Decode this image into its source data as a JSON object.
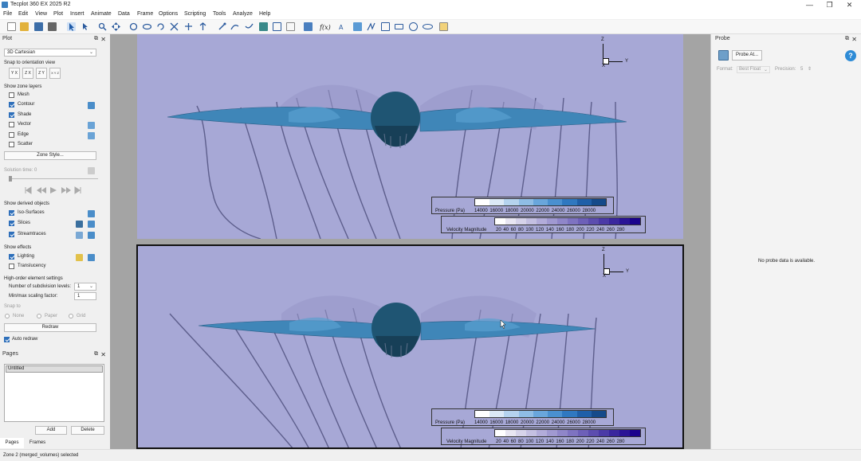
{
  "window": {
    "title": "Tecplot 360 EX 2025 R2",
    "controls": [
      "—",
      "❐",
      "✕"
    ]
  },
  "menu": [
    "File",
    "Edit",
    "View",
    "Plot",
    "Insert",
    "Animate",
    "Data",
    "Frame",
    "Options",
    "Scripting",
    "Tools",
    "Analyze",
    "Help"
  ],
  "plot_panel": {
    "title": "Plot",
    "plot_type": "3D Cartesian",
    "snap_label": "Snap to orientation view",
    "snap_views": [
      "Y X",
      "Z X",
      "Z Y",
      "X Y Z"
    ],
    "zone_layers_label": "Show zone layers",
    "zone_layers": [
      {
        "label": "Mesh",
        "checked": false
      },
      {
        "label": "Contour",
        "checked": true
      },
      {
        "label": "Shade",
        "checked": true
      },
      {
        "label": "Vector",
        "checked": false
      },
      {
        "label": "Edge",
        "checked": false
      },
      {
        "label": "Scatter",
        "checked": false
      }
    ],
    "zone_style_button": "Zone Style...",
    "solution_time": "Solution time: 0",
    "derived_label": "Show derived objects",
    "derived": [
      {
        "label": "Iso-Surfaces",
        "checked": true
      },
      {
        "label": "Slices",
        "checked": true
      },
      {
        "label": "Streamtraces",
        "checked": true
      }
    ],
    "effects_label": "Show effects",
    "effects": [
      {
        "label": "Lighting",
        "checked": true
      },
      {
        "label": "Translucency",
        "checked": false
      }
    ],
    "high_order_label": "High-order element settings",
    "subdivision_label": "Number of subdivision levels:",
    "subdivision_value": "1",
    "scaling_label": "Min/max scaling factor:",
    "scaling_value": "1",
    "snap_to_label": "Snap to",
    "snap_to_options": [
      "None",
      "Paper",
      "Grid"
    ],
    "redraw_button": "Redraw",
    "auto_redraw_label": "Auto redraw",
    "auto_redraw_checked": true
  },
  "pages_panel": {
    "title": "Pages",
    "items": [
      "Untitled"
    ],
    "add_button": "Add",
    "delete_button": "Delete",
    "tabs": [
      "Pages",
      "Frames"
    ]
  },
  "status": "Zone 2 (merged_volumes) selected",
  "frames": [
    {
      "axis": {
        "z": "Z",
        "y": "Y",
        "x": "X"
      },
      "pressure_legend": {
        "label": "Pressure (Pa)",
        "ticks": "14000 16000 18000 20000 22000 24000 26000 28000"
      },
      "velocity_legend": {
        "label": "Velocity Magnitude",
        "ticks": "20 40 60 80 100 120 140 160 180 200 220 240 260 280"
      }
    },
    {
      "axis": {
        "z": "Z",
        "y": "Y",
        "x": "X"
      },
      "pressure_legend": {
        "label": "Pressure (Pa)",
        "ticks": "14000 16000 18000 20000 22000 24000 26000 28000"
      },
      "velocity_legend": {
        "label": "Velocity Magnitude",
        "ticks": "20 40 60 80 100 120 140 160 180 200 220 240 260 280"
      }
    }
  ],
  "probe_panel": {
    "title": "Probe",
    "probe_button": "Probe At...",
    "format_label": "Format:",
    "format_value": "Best Float",
    "precision_label": "Precision:",
    "precision_value": "5",
    "empty_message": "No probe data is available."
  },
  "colors": {
    "frame_bg": "#a7a8d6",
    "accent": "#2e6fba",
    "pressure_scale": [
      "#ffffff",
      "#dbe9f6",
      "#b5d3ee",
      "#8fbde5",
      "#69a6dc",
      "#4a90d0",
      "#2f78c0",
      "#1f5fa8",
      "#154a8a"
    ],
    "velocity_scale": [
      "#ffffff",
      "#e8e6f2",
      "#d6d3ea",
      "#c4c0e2",
      "#b2acda",
      "#a099d1",
      "#8f86c9",
      "#7e73c1",
      "#6d60b8",
      "#5c4daf",
      "#4b3aa7",
      "#3a279e",
      "#2a1496",
      "#1a028d"
    ]
  }
}
